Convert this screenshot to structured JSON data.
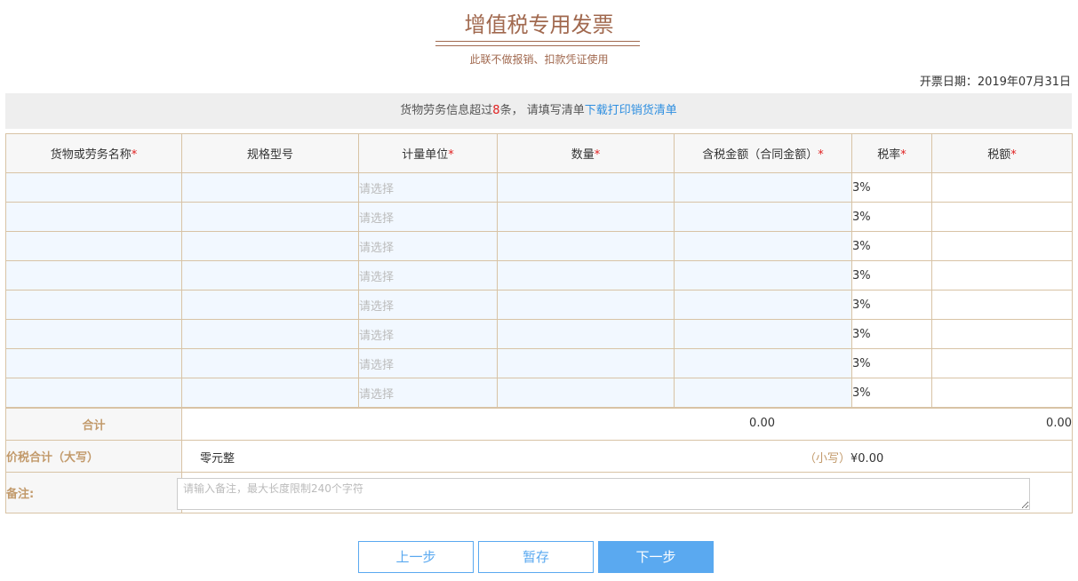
{
  "header": {
    "title": "增值税专用发票",
    "subtitle": "此联不做报销、扣款凭证使用",
    "date_label": "开票日期：",
    "date_value": "2019年07月31日"
  },
  "notice": {
    "prefix": "货物劳务信息超过",
    "count": "8",
    "suffix": "条，  请填写清单",
    "link": "下载打印销货清单"
  },
  "table": {
    "columns": [
      {
        "label": "货物或劳务名称",
        "required": "*"
      },
      {
        "label": "规格型号",
        "required": ""
      },
      {
        "label": "计量单位",
        "required": "*"
      },
      {
        "label": "数量",
        "required": "*"
      },
      {
        "label": "含税金额（合同金额）",
        "required": "*"
      },
      {
        "label": "税率",
        "required": "*"
      },
      {
        "label": "税额",
        "required": "*"
      }
    ],
    "rows": [
      {
        "unit_placeholder": "请选择",
        "rate": "3%"
      },
      {
        "unit_placeholder": "请选择",
        "rate": "3%"
      },
      {
        "unit_placeholder": "请选择",
        "rate": "3%"
      },
      {
        "unit_placeholder": "请选择",
        "rate": "3%"
      },
      {
        "unit_placeholder": "请选择",
        "rate": "3%"
      },
      {
        "unit_placeholder": "请选择",
        "rate": "3%"
      },
      {
        "unit_placeholder": "请选择",
        "rate": "3%"
      },
      {
        "unit_placeholder": "请选择",
        "rate": "3%"
      }
    ]
  },
  "summary": {
    "total_label": "合计",
    "amount_total": "0.00",
    "tax_total": "0.00",
    "grand_label": "价税合计（大写）",
    "grand_upper": "零元整",
    "small_label": "（小写）",
    "grand_lower": "¥0.00",
    "remark_label": "备注:",
    "remark_placeholder": "请输入备注，最大长度限制240个字符"
  },
  "buttons": {
    "prev": "上一步",
    "save": "暂存",
    "next": "下一步"
  },
  "colors": {
    "brand": "#a1694f",
    "label": "#c29a6b",
    "primary": "#5aa9f0",
    "required": "#e02020",
    "link": "#2f8fe0"
  }
}
